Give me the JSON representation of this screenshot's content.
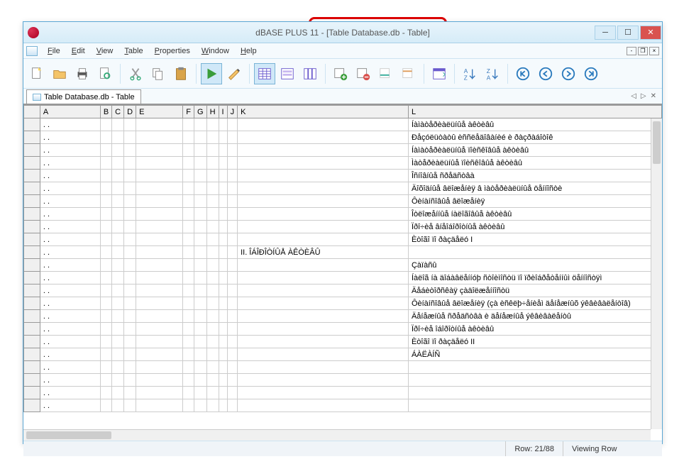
{
  "title": "dBASE PLUS 11 - [Table Database.db - Table]",
  "menu": [
    "File",
    "Edit",
    "View",
    "Table",
    "Properties",
    "Window",
    "Help"
  ],
  "tab": {
    "label": "Table Database.db - Table"
  },
  "columns": [
    "A",
    "B",
    "C",
    "D",
    "E",
    "F",
    "G",
    "H",
    "I",
    "J",
    "K",
    "L"
  ],
  "rows": [
    {
      "a": ". .",
      "k": "",
      "l": "Íàìàòåðèàëüíûå àêòèâû"
    },
    {
      "a": ". .",
      "k": "",
      "l": "Ðåçóëüòàòû èññëåäîâàíèé è ðàçðàáîòîê"
    },
    {
      "a": ". .",
      "k": "",
      "l": "Íàìàòåðèàëüíûå ïîèñêîâûå àêòèâû"
    },
    {
      "a": ". .",
      "k": "",
      "l": "Ìàòåðèàëüíûå ïîèñêîâûå àêòèâû"
    },
    {
      "a": ". .",
      "k": "",
      "l": "Îñíîâíûå ñðåäñòâà"
    },
    {
      "a": ". .",
      "k": "",
      "l": "Äîõîäíûå âëîæåíèÿ â ìàòåðèàëüíûå öåííîñòè"
    },
    {
      "a": ". .",
      "k": "",
      "l": "Ôèíàíñîâûå âëîæåíèÿ"
    },
    {
      "a": ". .",
      "k": "",
      "l": "Îòëîæåííûå íàëîãîâûå àêòèâû"
    },
    {
      "a": ". .",
      "k": "",
      "l": "Ïðî÷èå âíåîáîðîòíûå àêòèâû"
    },
    {
      "a": ". .",
      "k": "",
      "l": "Èòîãî ïî ðàçäåëó I"
    },
    {
      "a": ". .",
      "k": "II. ÎÁÎÐÎÒÍÛÅ ÀÊÒÈÂÛ",
      "l": ""
    },
    {
      "a": ". .",
      "k": "",
      "l": "Çàïàñû"
    },
    {
      "a": ". .",
      "k": "",
      "l": "Íàëîã íà äîáàâëåííóþ ñòîèìîñòü ïî ïðèîáðåòåííûì öåííîñòÿì"
    },
    {
      "a": ". .",
      "k": "",
      "l": "Äåáèòîðñêàÿ çàäîëæåííîñòü"
    },
    {
      "a": ". .",
      "k": "",
      "l": "Ôèíàíñîâûå âëîæåíèÿ (çà èñêëþ÷åíèåì äåíåæíûõ ýêâèâàëåíòîâ)"
    },
    {
      "a": ". .",
      "k": "",
      "l": "Äåíåæíûå ñðåäñòâà è äåíåæíûå ýêâèâàëåíòû"
    },
    {
      "a": ". .",
      "k": "",
      "l": "Ïðî÷èå îáîðîòíûå àêòèâû"
    },
    {
      "a": ". .",
      "k": "",
      "l": "Èòîãî ïî ðàçäåëó II"
    },
    {
      "a": ". .",
      "k": "",
      "l": "ÁÀËÀÍÑ"
    },
    {
      "a": ". .",
      "k": "",
      "l": ""
    },
    {
      "a": ". .",
      "k": "",
      "l": ""
    },
    {
      "a": ". .",
      "k": "",
      "l": ""
    },
    {
      "a": ". .",
      "k": "",
      "l": ""
    }
  ],
  "status": {
    "row": "Row: 21/88",
    "mode": "Viewing Row"
  },
  "toolbar_icons": [
    "new-doc",
    "open",
    "print",
    "print-preview",
    "cut",
    "copy",
    "paste",
    "run",
    "design",
    "table-view",
    "form-view",
    "column-view",
    "add-record",
    "delete-record",
    "next-record",
    "last-record",
    "fields",
    "sort-asc",
    "sort-desc",
    "nav-first",
    "nav-prev",
    "nav-next",
    "nav-last"
  ]
}
